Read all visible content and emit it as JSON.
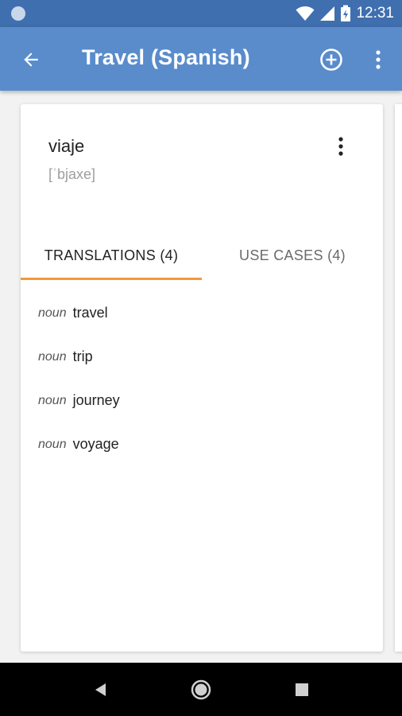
{
  "status_bar": {
    "time": "12:31"
  },
  "app_bar": {
    "title": "Travel (Spanish)",
    "icons": {
      "back": "arrow-back-icon",
      "add": "add-circle-icon",
      "more": "more-vert-icon"
    }
  },
  "card": {
    "word": "viaje",
    "phonetic": "[ˈbjaxe]",
    "tabs": [
      {
        "label": "TRANSLATIONS (4)",
        "active": true
      },
      {
        "label": "USE CASES (4)",
        "active": false
      }
    ],
    "translations": [
      {
        "pos": "noun",
        "meaning": "travel"
      },
      {
        "pos": "noun",
        "meaning": "trip"
      },
      {
        "pos": "noun",
        "meaning": "journey"
      },
      {
        "pos": "noun",
        "meaning": "voyage"
      }
    ]
  },
  "colors": {
    "status_bar": "#3f6fae",
    "app_bar": "#5a8ccc",
    "tab_indicator": "#f29a3a",
    "background": "#f2f2f2"
  },
  "nav_bar": {
    "icons": [
      "back-triangle-icon",
      "home-circle-icon",
      "recents-square-icon"
    ]
  }
}
